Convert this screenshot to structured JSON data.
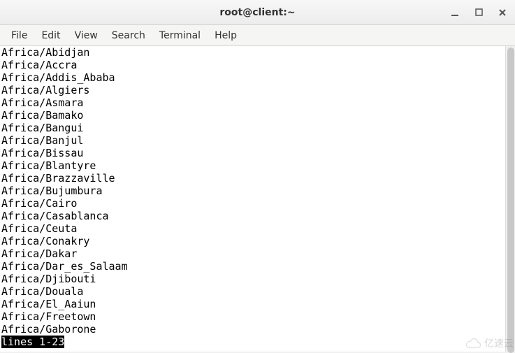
{
  "window": {
    "title": "root@client:~"
  },
  "menubar": {
    "items": [
      "File",
      "Edit",
      "View",
      "Search",
      "Terminal",
      "Help"
    ]
  },
  "terminal": {
    "lines": [
      "Africa/Abidjan",
      "Africa/Accra",
      "Africa/Addis_Ababa",
      "Africa/Algiers",
      "Africa/Asmara",
      "Africa/Bamako",
      "Africa/Bangui",
      "Africa/Banjul",
      "Africa/Bissau",
      "Africa/Blantyre",
      "Africa/Brazzaville",
      "Africa/Bujumbura",
      "Africa/Cairo",
      "Africa/Casablanca",
      "Africa/Ceuta",
      "Africa/Conakry",
      "Africa/Dakar",
      "Africa/Dar_es_Salaam",
      "Africa/Djibouti",
      "Africa/Douala",
      "Africa/El_Aaiun",
      "Africa/Freetown",
      "Africa/Gaborone"
    ],
    "status": "lines 1-23"
  },
  "watermark": {
    "text": "亿速云"
  }
}
